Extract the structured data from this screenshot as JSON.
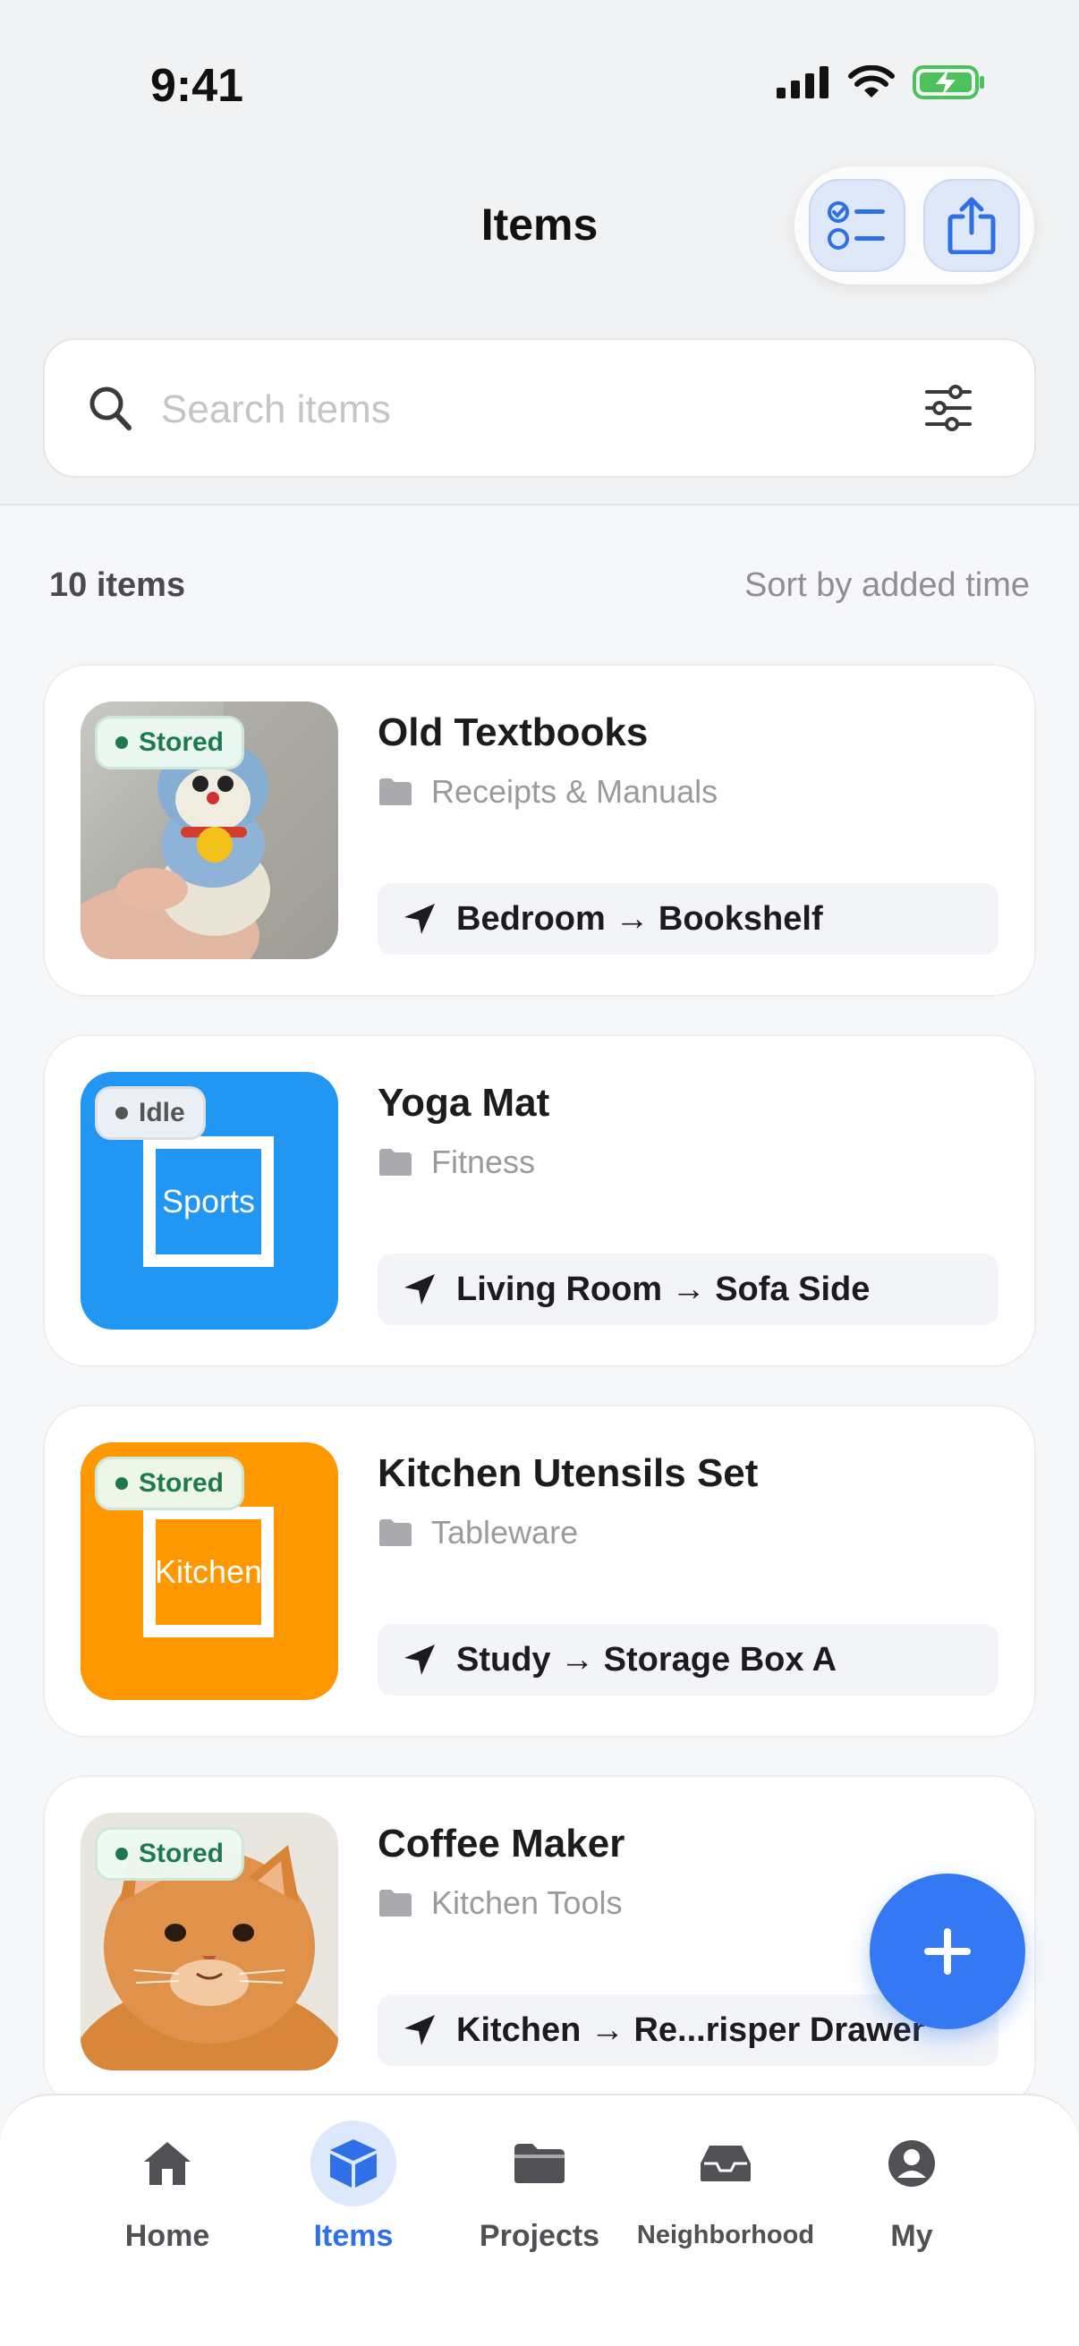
{
  "status_bar": {
    "time": "9:41"
  },
  "header": {
    "title": "Items"
  },
  "search": {
    "placeholder": "Search items",
    "value": ""
  },
  "list_header": {
    "count": "10 items",
    "sort": "Sort by added time"
  },
  "items": [
    {
      "title": "Old Textbooks",
      "status": "Stored",
      "category": "Receipts & Manuals",
      "location": "Bedroom → Bookshelf",
      "thumb": "photo-plush-toy"
    },
    {
      "title": "Yoga Mat",
      "status": "Idle",
      "category": "Fitness",
      "location": "Living Room → Sofa Side",
      "thumb_text": "Sports",
      "thumb_color": "#2196f3"
    },
    {
      "title": "Kitchen Utensils Set",
      "status": "Stored",
      "category": "Tableware",
      "location": "Study → Storage Box A",
      "thumb_text": "Kitchen",
      "thumb_color": "#ff9800"
    },
    {
      "title": "Coffee Maker",
      "status": "Stored",
      "category": "Kitchen Tools",
      "location": "Kitchen → Re...risper Drawer",
      "thumb": "photo-orange-cat"
    }
  ],
  "tabs": [
    {
      "label": "Home",
      "icon": "home-icon"
    },
    {
      "label": "Items",
      "icon": "cube-icon",
      "active": true
    },
    {
      "label": "Projects",
      "icon": "folder-icon"
    },
    {
      "label": "Neighborhood",
      "icon": "inbox-icon"
    },
    {
      "label": "My",
      "icon": "person-icon"
    }
  ],
  "colors": {
    "accent": "#3578f3",
    "stored_green": "#1e7a4e"
  }
}
